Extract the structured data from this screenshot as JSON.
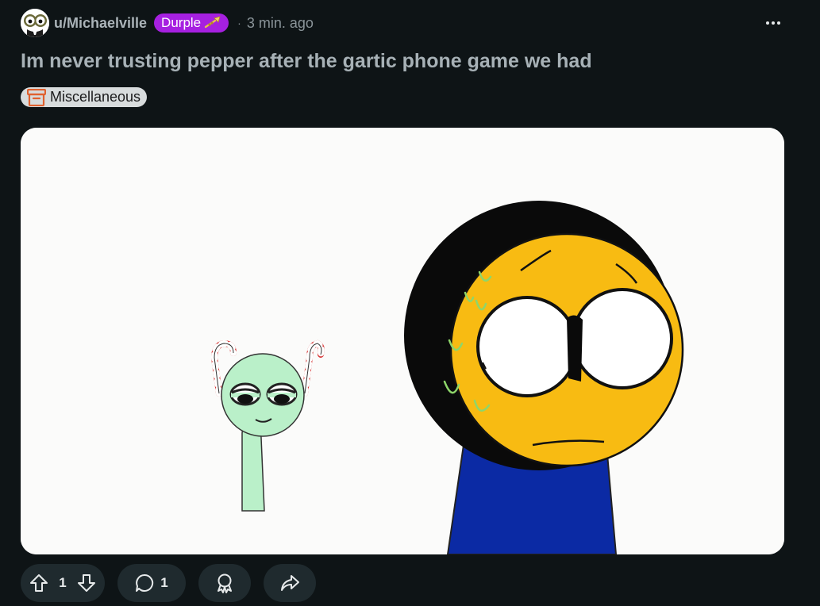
{
  "post": {
    "author": "u/Michaelville",
    "user_flair": "Durple",
    "separator": "·",
    "timestamp": "3 min. ago",
    "title": "Im never trusting pepper after the gartic phone game we had",
    "post_flair": "Miscellaneous"
  },
  "actions": {
    "upvotes": "1",
    "comments": "1"
  },
  "icons": {
    "avatar": "avatar-image",
    "user_flair_emoji": "trumpet-icon",
    "post_flair_emoji": "archive-box-icon",
    "overflow": "more-horizontal-icon",
    "upvote": "arrow-up-icon",
    "downvote": "arrow-down-icon",
    "comment": "speech-bubble-icon",
    "award": "award-icon",
    "share": "share-arrow-icon"
  },
  "colors": {
    "background": "#0e1416",
    "user_flair_bg": "#a620e0",
    "post_flair_bg": "#d8dcdd",
    "pill_bg": "#1f2a2e",
    "title": "#a7b1b6"
  }
}
